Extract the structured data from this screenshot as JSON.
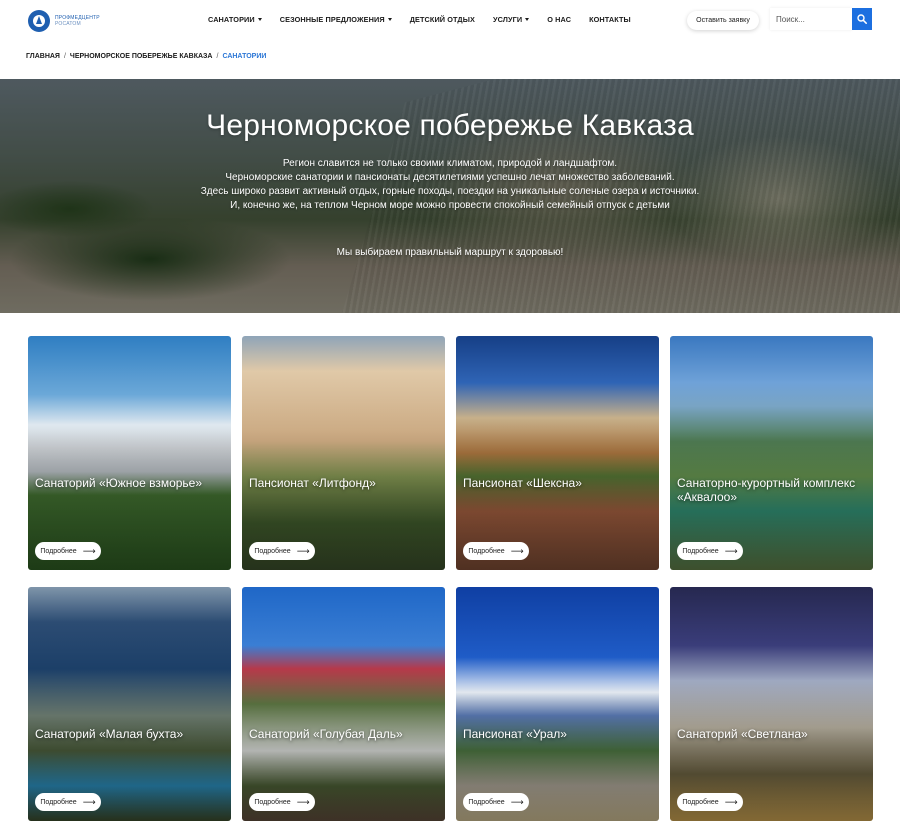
{
  "header": {
    "logo": {
      "line1": "ПРОФМЕДЦЕНТР",
      "line2": "РОСАТОМ"
    },
    "nav": [
      {
        "label": "САНАТОРИИ",
        "has_dropdown": true
      },
      {
        "label": "СЕЗОННЫЕ ПРЕДЛОЖЕНИЯ",
        "has_dropdown": true
      },
      {
        "label": "ДЕТСКИЙ ОТДЫХ",
        "has_dropdown": false
      },
      {
        "label": "УСЛУГИ",
        "has_dropdown": true
      },
      {
        "label": "О НАС",
        "has_dropdown": false
      },
      {
        "label": "КОНТАКТЫ",
        "has_dropdown": false
      }
    ],
    "request_button": "Оставить заявку",
    "search": {
      "placeholder": "Поиск...",
      "value": "",
      "icon": "search-icon",
      "accent": "#1c6fe0"
    }
  },
  "breadcrumb": {
    "items": [
      "ГЛАВНАЯ",
      "ЧЕРНОМОРСКОЕ ПОБЕРЕЖЬЕ КАВКАЗА"
    ],
    "current": "САНАТОРИИ",
    "separator": "/",
    "current_color": "#2c77d6"
  },
  "hero": {
    "title": "Черноморское побережье Кавказа",
    "lines": [
      "Регион славится не только своими климатом, природой и ландшафтом.",
      "Черноморские санатории и пансионаты десятилетиями успешно лечат множество заболеваний.",
      "Здесь широко развит активный отдых, горные походы, поездки на уникальные соленые озера и источники.",
      "И, конечно же, на теплом Черном море можно провести спокойный семейный отпуск с детьми"
    ],
    "motto": "Мы выбираем правильный маршрут к здоровью!"
  },
  "cards": [
    {
      "title": "Санаторий «Южное взморье»",
      "button": "Подробнее"
    },
    {
      "title": "Пансионат «Литфонд»",
      "button": "Подробнее"
    },
    {
      "title": "Пансионат «Шексна»",
      "button": "Подробнее"
    },
    {
      "title": "Санаторно-курортный комплекс «Аквалоо»",
      "button": "Подробнее"
    },
    {
      "title": "Санаторий «Малая бухта»",
      "button": "Подробнее"
    },
    {
      "title": "Санаторий «Голубая Даль»",
      "button": "Подробнее"
    },
    {
      "title": "Пансионат «Урал»",
      "button": "Подробнее"
    },
    {
      "title": "Санаторий «Светлана»",
      "button": "Подробнее"
    }
  ],
  "card_button_arrow": "⟶"
}
